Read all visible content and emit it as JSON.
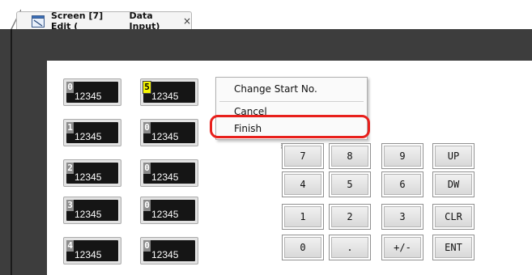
{
  "tab": {
    "title_part1": "Screen [7] Edit (",
    "title_part2": "Data Input)",
    "close": "×"
  },
  "icons": {
    "tab_icon": "screen-edit-icon",
    "close": "close-icon",
    "resize_grip": "resize-grip-icon"
  },
  "displays": [
    {
      "badge": "0",
      "value": "12345",
      "highlight": false
    },
    {
      "badge": "5",
      "value": "12345",
      "highlight": true
    },
    {
      "badge": "1",
      "value": "12345",
      "highlight": false
    },
    {
      "badge": "0",
      "value": "12345",
      "highlight": false
    },
    {
      "badge": "2",
      "value": "12345",
      "highlight": false
    },
    {
      "badge": "0",
      "value": "12345",
      "highlight": false
    },
    {
      "badge": "3",
      "value": "12345",
      "highlight": false
    },
    {
      "badge": "0",
      "value": "12345",
      "highlight": false
    },
    {
      "badge": "4",
      "value": "12345",
      "highlight": false
    },
    {
      "badge": "0",
      "value": "12345",
      "highlight": false
    }
  ],
  "keypad": {
    "keys": [
      "7",
      "8",
      "9",
      "UP",
      "4",
      "5",
      "6",
      "DW",
      "1",
      "2",
      "3",
      "CLR",
      "0",
      ".",
      "+/-",
      "ENT"
    ]
  },
  "context_menu": {
    "change_start": "Change Start No.",
    "cancel": "Cancel",
    "finish": "Finish"
  },
  "colors": {
    "highlight_ring": "#e8201c",
    "badge_highlight": "#f6f600",
    "editor_background": "#3d3d3d"
  }
}
